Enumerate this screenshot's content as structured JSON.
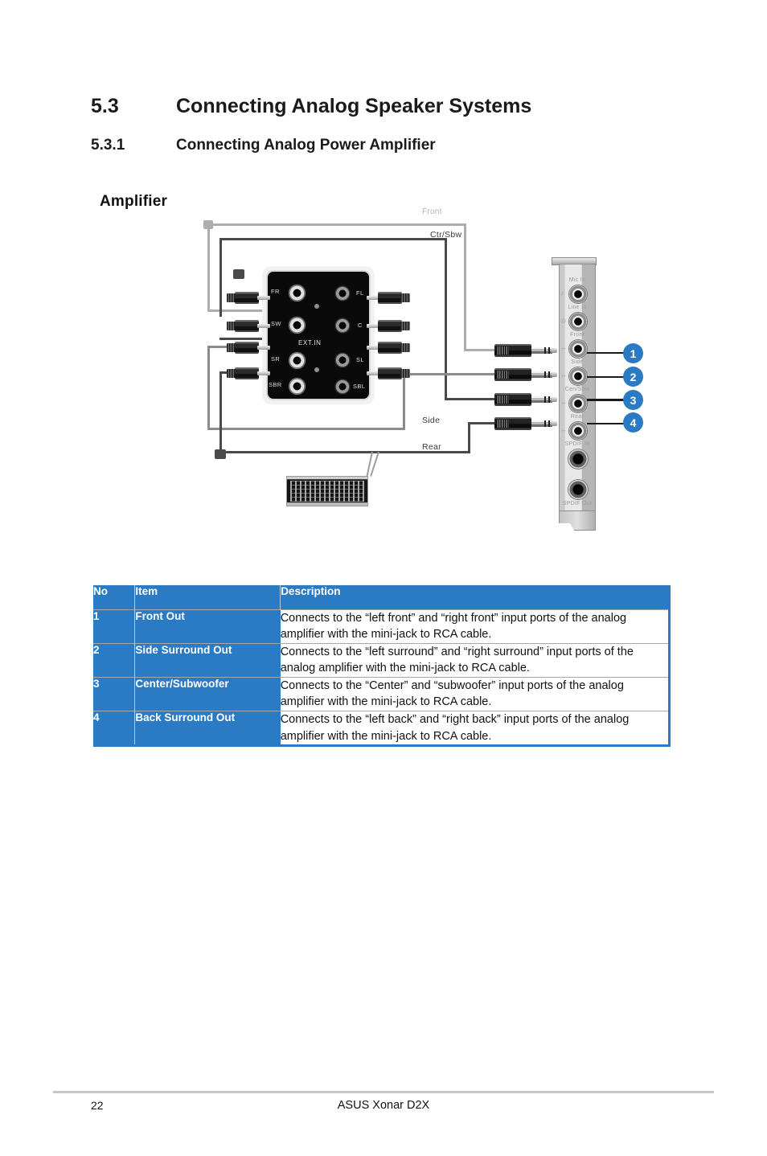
{
  "page": {
    "number": "22",
    "footer_title": "ASUS Xonar D2X"
  },
  "headings": {
    "section": {
      "number": "5.3",
      "title": "Connecting Analog Speaker Systems"
    },
    "subsection": {
      "number": "5.3.1",
      "title": "Connecting Analog Power Amplifier"
    }
  },
  "diagram": {
    "amplifier_label": "Amplifier",
    "cable_labels": {
      "front": "Front",
      "ctr_sbw": "Ctr/Sbw",
      "side": "Side",
      "rear": "Rear"
    },
    "amp_panel": {
      "ext_in": "EXT.IN",
      "jacks": [
        {
          "label": "FR",
          "side": "left"
        },
        {
          "label": "FL",
          "side": "right"
        },
        {
          "label": "SW",
          "side": "left"
        },
        {
          "label": "C",
          "side": "right"
        },
        {
          "label": "SR",
          "side": "left"
        },
        {
          "label": "SL",
          "side": "right"
        },
        {
          "label": "SBR",
          "side": "left"
        },
        {
          "label": "SBL",
          "side": "right"
        }
      ]
    },
    "card_ports": [
      {
        "label": "Mic In",
        "glyph": "♪"
      },
      {
        "label": "Line In",
        "glyph": "◎"
      },
      {
        "label": "Front",
        "glyph": "↔"
      },
      {
        "label": "Side",
        "glyph": "↔"
      },
      {
        "label": "Cen/Sbw",
        "glyph": "↔"
      },
      {
        "label": "Rear",
        "glyph": "↔"
      },
      {
        "label": "SPDIF In",
        "glyph": ""
      },
      {
        "label": "SPDIF Out",
        "glyph": ""
      }
    ],
    "callouts": [
      {
        "number": "1"
      },
      {
        "number": "2"
      },
      {
        "number": "3"
      },
      {
        "number": "4"
      }
    ]
  },
  "table": {
    "headers": {
      "no": "No",
      "item": "Item",
      "description": "Description"
    },
    "rows": [
      {
        "no": "1",
        "item": "Front Out",
        "description": "Connects to the “left front” and “right front” input ports of the analog amplifier with the mini-jack to RCA cable."
      },
      {
        "no": "2",
        "item": "Side Surround Out",
        "description": "Connects to the “left surround” and “right surround” input ports of the analog amplifier with the mini-jack to RCA cable."
      },
      {
        "no": "3",
        "item": "Center/Subwoofer",
        "description": "Connects to the “Center” and “subwoofer” input ports of the analog amplifier with the mini-jack to RCA cable."
      },
      {
        "no": "4",
        "item": "Back Surround Out",
        "description": "Connects to the “left back” and “right back” input ports of the analog amplifier with the mini-jack to RCA cable."
      }
    ]
  },
  "colors": {
    "accent_blue": "#2b7bc4",
    "rule_gray": "#c6c6c6",
    "text_black": "#111111"
  }
}
